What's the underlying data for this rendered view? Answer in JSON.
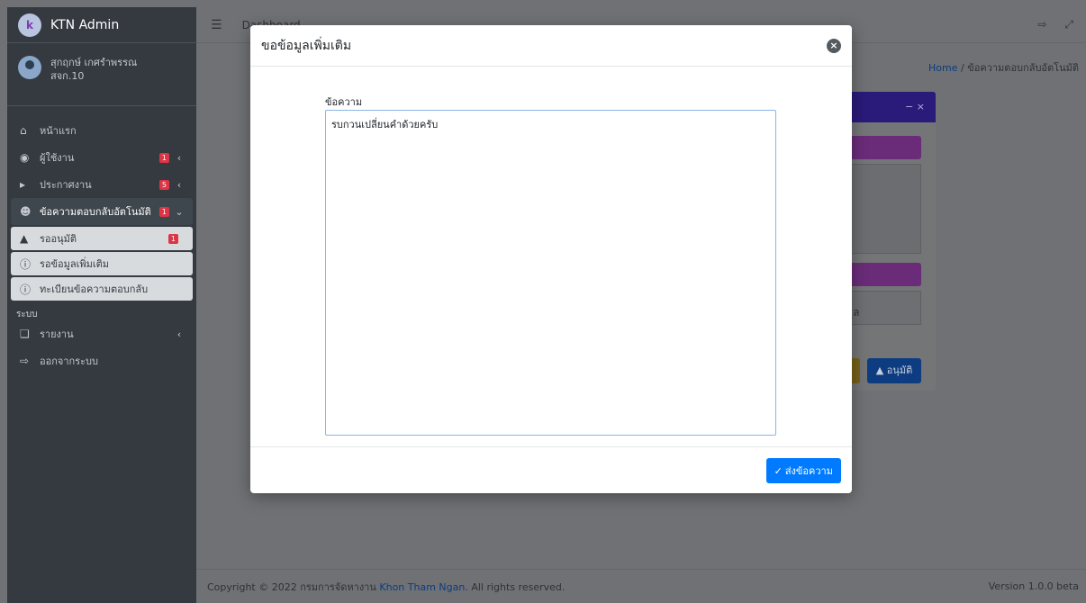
{
  "sidebar": {
    "brand_title": "KTN Admin",
    "brand_logo_text": "k",
    "user_name": "สุกฤกษ์ เกศรำพรรณ",
    "user_role": "สจก.10",
    "items": [
      {
        "label": "หน้าแรก",
        "icon": "home-icon"
      },
      {
        "label": "ผู้ใช้งาน",
        "badge": "1",
        "icon": "user-circle-icon"
      },
      {
        "label": "ประกาศงาน",
        "badge": "5",
        "icon": "megaphone-icon"
      },
      {
        "label": "ข้อความตอบกลับอัตโนมัติ",
        "badge": "1",
        "icon": "users-cog-icon"
      }
    ],
    "sub_items": [
      {
        "label": "รออนุมัติ",
        "badge": "1",
        "icon": "thumbs-up-icon"
      },
      {
        "label": "รอข้อมูลเพิ่มเติม",
        "icon": "info-circle-icon"
      },
      {
        "label": "ทะเบียนข้อความตอบกลับ",
        "icon": "info-circle-icon"
      }
    ],
    "section_header": "ระบบ",
    "system_items": [
      {
        "label": "รายงาน",
        "icon": "clone-icon"
      },
      {
        "label": "ออกจากระบบ",
        "icon": "sign-out-icon"
      }
    ]
  },
  "topbar": {
    "link": "Dashboard"
  },
  "breadcrumb": {
    "home": "Home",
    "separator": "/",
    "current": "ข้อความตอบกลับอัตโนมัติ"
  },
  "background_card": {
    "header_controls": "−   ×",
    "box_text": "อมูล",
    "approve_label": "อนุมัติ"
  },
  "modal": {
    "title": "ขอข้อมูลเพิ่มเติม",
    "field_label": "ข้อความ",
    "field_value": "รบกวนเปลี่ยนคำด้วยครับ",
    "send_label": "ส่งข้อความ"
  },
  "footer": {
    "copyright_prefix": "Copyright © 2022 กรมการจัดหางาน ",
    "org": "Khon Tham Ngan",
    "copyright_suffix": ". All rights reserved.",
    "version": "Version 1.0.0 beta"
  },
  "colors": {
    "primary": "#007bff",
    "sidebar": "#343a40",
    "badge": "#dc3545",
    "overlay": "#6f7174"
  }
}
